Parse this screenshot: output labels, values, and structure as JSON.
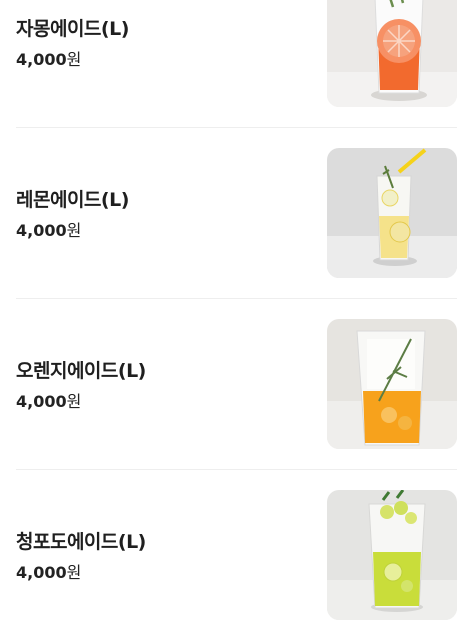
{
  "menu": {
    "items": [
      {
        "name": "자몽에이드(L)",
        "price": "4,000",
        "currency": "원",
        "drink": "grapefruit-ade-drink-photo",
        "accent": "#f26a2e"
      },
      {
        "name": "레몬에이드(L)",
        "price": "4,000",
        "currency": "원",
        "drink": "lemon-ade-drink-photo",
        "accent": "#f5d64a"
      },
      {
        "name": "오렌지에이드(L)",
        "price": "4,000",
        "currency": "원",
        "drink": "orange-ade-drink-photo",
        "accent": "#f7a21c"
      },
      {
        "name": "청포도에이드(L)",
        "price": "4,000",
        "currency": "원",
        "drink": "green-grape-ade-drink-photo",
        "accent": "#c9dd3a"
      }
    ]
  },
  "colors": {
    "divider": "#eeeeee",
    "text": "#1f1f1f",
    "photo_bg": "#e8e6e4"
  }
}
